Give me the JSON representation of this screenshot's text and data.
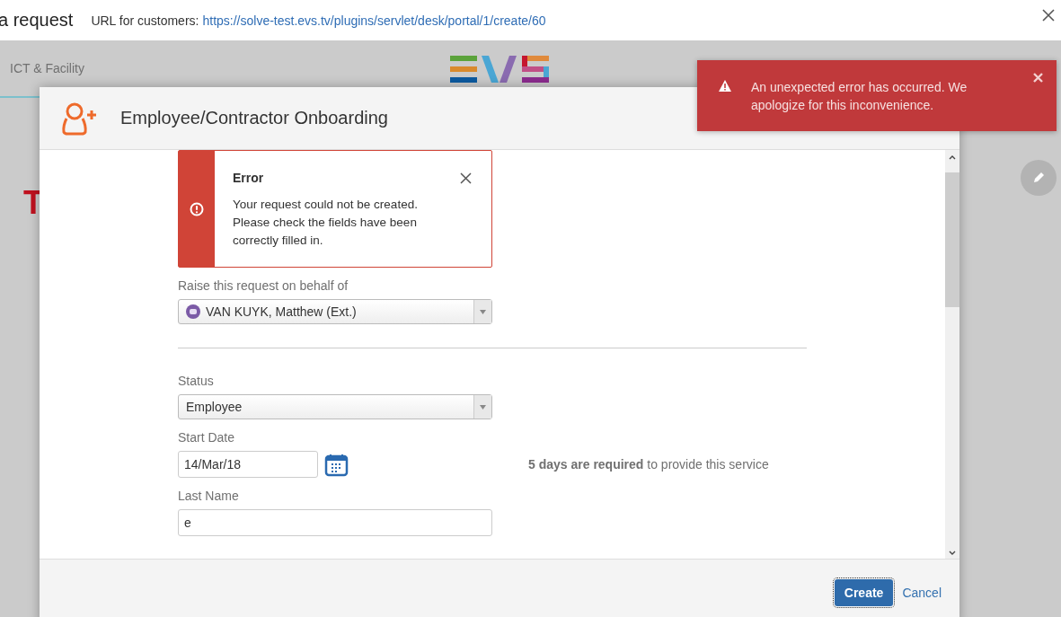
{
  "top_bar": {
    "title": "a request",
    "url_label": "URL for customers:",
    "url": "https://solve-test.evs.tv/plugins/servlet/desk/portal/1/create/60"
  },
  "portal": {
    "nav_label": "ICT & Facility",
    "heading_fragment": "T"
  },
  "modal": {
    "title": "Employee/Contractor Onboarding",
    "error": {
      "title": "Error",
      "message": "Your request could not be created. Please check the fields have been correctly filled in."
    },
    "fields": [
      {
        "kind": "user-select",
        "label": "Raise this request on behalf of",
        "value": "VAN KUYK, Matthew (Ext.)"
      },
      {
        "kind": "divider"
      },
      {
        "kind": "select",
        "label": "Status",
        "value": "Employee"
      },
      {
        "kind": "date",
        "label": "Start Date",
        "value": "14/Mar/18",
        "note": "**5 days are required** to provide this service"
      },
      {
        "kind": "text",
        "label": "Last Name",
        "value": "e"
      }
    ],
    "buttons": [
      {
        "kind": "primary",
        "label": "Create"
      },
      {
        "kind": "link",
        "label": "Cancel"
      }
    ]
  },
  "toast": {
    "message": "An unexpected error has occurred. We apologize for this inconvenience."
  }
}
